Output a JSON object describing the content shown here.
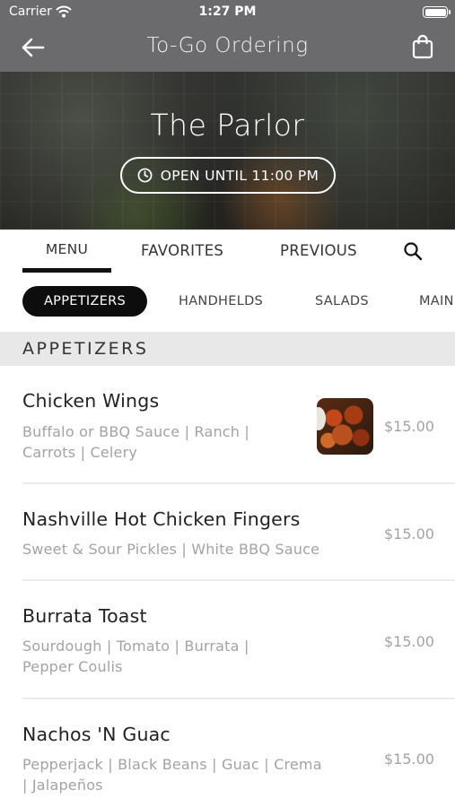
{
  "status_bar": {
    "carrier": "Carrier",
    "time": "1:27 PM"
  },
  "nav": {
    "title": "To-Go Ordering",
    "back_icon": "arrow-left-icon",
    "cart_icon": "shopping-bag-icon"
  },
  "restaurant": {
    "name": "The Parlor",
    "hours": "OPEN UNTIL 11:00 PM",
    "hours_icon": "clock-icon"
  },
  "tabs": {
    "menu": "MENU",
    "favorites": "FAVORITES",
    "previous": "PREVIOUS",
    "active": "MENU",
    "search_icon": "search-icon"
  },
  "categories": {
    "items": [
      "APPETIZERS",
      "HANDHELDS",
      "SALADS",
      "MAIN"
    ],
    "active": "APPETIZERS"
  },
  "section": {
    "title": "APPETIZERS"
  },
  "menu_items": [
    {
      "name": "Chicken Wings",
      "desc_lines": [
        "Buffalo or BBQ Sauce | Ranch |",
        "Carrots | Celery"
      ],
      "price": "$15.00",
      "has_image": true
    },
    {
      "name": "Nashville Hot Chicken Fingers",
      "desc_lines": [
        "Sweet & Sour Pickles | White BBQ Sauce"
      ],
      "price": "$15.00",
      "has_image": false
    },
    {
      "name": "Burrata Toast",
      "desc_lines": [
        "Sourdough | Tomato | Burrata |",
        "Pepper Coulis"
      ],
      "price": "$15.00",
      "has_image": false
    },
    {
      "name": "Nachos 'N Guac",
      "desc_lines": [
        "Pepperjack | Black Beans | Guac | Crema",
        "| Jalapeños"
      ],
      "price": "$15.00",
      "has_image": false
    }
  ],
  "colors": {
    "header": "#6b6b6e",
    "active_chip": "#0d0d0d",
    "muted_text": "#a3a3a3",
    "section_bg": "#e8e8e8"
  }
}
